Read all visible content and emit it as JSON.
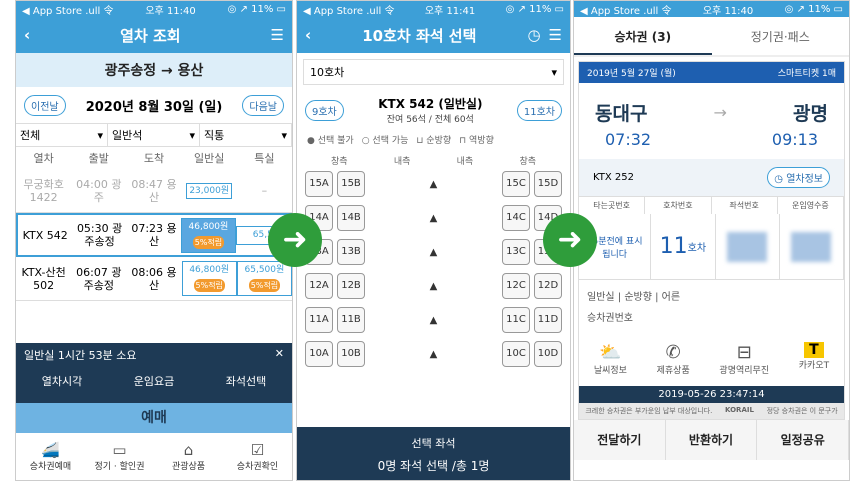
{
  "screen1": {
    "status": {
      "left": "◀ App Store .ull 令",
      "time": "오후 11:40",
      "right": "◎ ↗ 11% ▭"
    },
    "title": "열차 조회",
    "route": "광주송정 → 용산",
    "prev_day": "이전날",
    "date": "2020년 8월 30일 (일)",
    "next_day": "다음날",
    "filters": [
      "전체",
      "일반석",
      "직통"
    ],
    "columns": [
      "열차",
      "출발",
      "도착",
      "일반실",
      "특실"
    ],
    "rows": [
      {
        "train": "무궁화호 1422",
        "dep": "04:00 광주",
        "arr": "08:47 용산",
        "price": "23,000원",
        "special": "–"
      },
      {
        "train": "KTX 542",
        "dep": "05:30 광주송정",
        "arr": "07:23 용산",
        "price": "46,800원",
        "coupon": "5%적립",
        "special": "65,5"
      },
      {
        "train": "KTX-산천 502",
        "dep": "06:07 광주송정",
        "arr": "08:06 용산",
        "price": "46,800원",
        "coupon": "5%적립",
        "special": "65,500원",
        "special_coupon": "5%적립"
      }
    ],
    "panel": {
      "info": "일반실 1시간 53분 소요",
      "actions": [
        "열차시각",
        "운임요금",
        "좌석선택"
      ]
    },
    "book_button": "예매",
    "nav": [
      "승차권예매",
      "정기 · 할인권",
      "관광상품",
      "승차권확인"
    ]
  },
  "screen2": {
    "status": {
      "left": "◀ App Store .ull 令",
      "time": "오후 11:41",
      "right": "◎ ↗ 11% ▭"
    },
    "title": "10호차 좌석 선택",
    "car_select": "10호차",
    "prev_car": "9호차",
    "next_car": "11호차",
    "train_name": "KTX 542 (일반실)",
    "remain": "잔여 56석 / 전체 60석",
    "legend": [
      "선택 불가",
      "선택 가능",
      "순방향",
      "역방향"
    ],
    "side_labels": [
      "창측",
      "내측",
      "내측",
      "창측"
    ],
    "seats": [
      [
        "15A",
        "15B",
        "15C",
        "15D"
      ],
      [
        "14A",
        "14B",
        "14C",
        "14D"
      ],
      [
        "13A",
        "13B",
        "13C",
        "13D"
      ],
      [
        "12A",
        "12B",
        "12C",
        "12D"
      ],
      [
        "11A",
        "11B",
        "11C",
        "11D"
      ],
      [
        "10A",
        "10B",
        "10C",
        "10D"
      ]
    ],
    "selbar_title": "선택 좌석",
    "selbar_text": "0명 좌석 선택 /총 1명"
  },
  "screen3": {
    "status": {
      "left": "◀ App Store .ull 令",
      "time": "오후 11:40",
      "right": "◎ ↗ 11% ▭"
    },
    "tabs": [
      "승차권 (3)",
      "정기권·패스"
    ],
    "ticket_date": "2019년 5월 27일 (월)",
    "ticket_type": "스마트티켓 1매",
    "from": "동대구",
    "to": "광명",
    "dep_time": "07:32",
    "arr_time": "09:13",
    "train": "KTX 252",
    "train_info": "열차정보",
    "table_headers": [
      "타는곳번호",
      "호차번호",
      "좌석번호",
      "운임영수증"
    ],
    "platform_note": "15분전에 표시됩니다",
    "car_no": "11",
    "car_suffix": "호차",
    "seat_class": "일반실 | 순방향 | 어른",
    "ticket_no_label": "승차권번호",
    "icons": [
      "날씨정보",
      "제휴상품",
      "광명역리무진",
      "카카오T"
    ],
    "timestamp": "2019-05-26 23:47:14",
    "fine_left": "크레한 승차권은 부가운임 납부 대상입니다.",
    "fine_logo": "KORAIL",
    "fine_right": "정당 승차권은 이 문구가",
    "actions": [
      "전달하기",
      "반환하기",
      "일정공유"
    ]
  },
  "colors": {
    "primary": "#3d9fd7",
    "navy": "#1e3a55",
    "arrow": "#2f9d3b"
  }
}
